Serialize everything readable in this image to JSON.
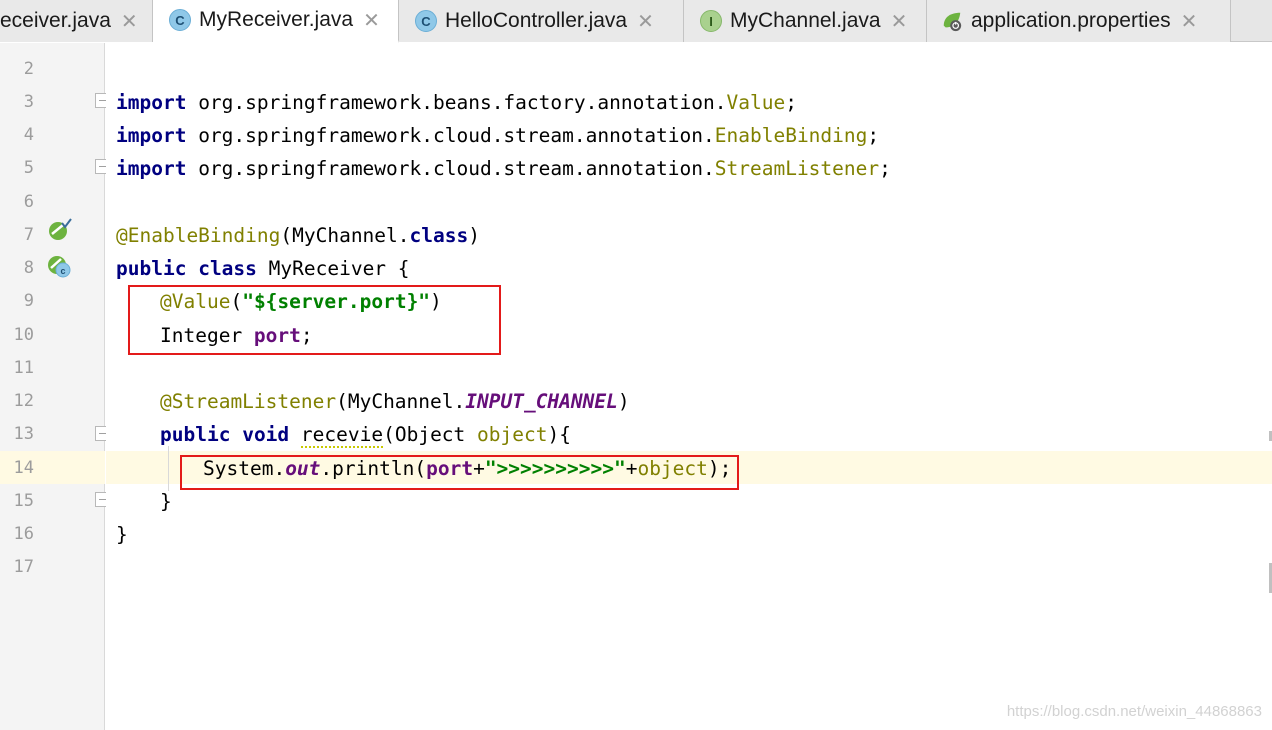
{
  "tabs": [
    {
      "label": "eceiver.java",
      "icon": "class-icon",
      "active": false
    },
    {
      "label": "MyReceiver.java",
      "icon": "class-icon",
      "active": true
    },
    {
      "label": "HelloController.java",
      "icon": "class-icon",
      "active": false
    },
    {
      "label": "MyChannel.java",
      "icon": "interface-icon",
      "active": false
    },
    {
      "label": "application.properties",
      "icon": "spring-properties-icon",
      "active": false
    }
  ],
  "tab_icon_letters": {
    "class": "C",
    "interface": "I"
  },
  "close_glyph": "✕",
  "line_numbers": [
    "2",
    "3",
    "4",
    "5",
    "6",
    "7",
    "8",
    "9",
    "10",
    "11",
    "12",
    "13",
    "14",
    "15",
    "16",
    "17"
  ],
  "code": {
    "l3": {
      "kw": "import",
      "pkg": " org.springframework.beans.factory.annotation.",
      "cls": "Value",
      "end": ";"
    },
    "l4": {
      "kw": "import",
      "pkg": " org.springframework.cloud.stream.annotation.",
      "cls": "EnableBinding",
      "end": ";"
    },
    "l5": {
      "kw": "import",
      "pkg": " org.springframework.cloud.stream.annotation.",
      "cls": "StreamListener",
      "end": ";"
    },
    "l7": {
      "ann": "@EnableBinding",
      "rest_a": "(MyChannel.",
      "kw": "class",
      "rest_b": ")"
    },
    "l8": {
      "kw1": "public",
      "kw2": "class",
      "name": " MyReceiver {"
    },
    "l9": {
      "ann": "@Value",
      "open": "(",
      "str": "\"${server.port}\"",
      "close": ")"
    },
    "l10": {
      "type": "Integer ",
      "field": "port",
      "end": ";"
    },
    "l12": {
      "ann": "@StreamListener",
      "rest_a": "(MyChannel.",
      "constant": "INPUT_CHANNEL",
      "rest_b": ")"
    },
    "l13": {
      "kw1": "public",
      "kw2": "void",
      "method": "recevie",
      "rest_a": "(Object ",
      "param": "object",
      "rest_b": "){"
    },
    "l14": {
      "a": "System.",
      "out": "out",
      "b": ".println(",
      "field": "port",
      "plus1": "+",
      "str": "\">>>>>>>>>>\"",
      "plus2": "+",
      "param": "object",
      "end": ");"
    },
    "l15": {
      "text": "}"
    },
    "l16": {
      "text": "}"
    }
  },
  "watermark": "https://blog.csdn.net/weixin_44868863",
  "colors": {
    "highlight_box": "#e31a1a",
    "caret_line": "#fffae3"
  }
}
